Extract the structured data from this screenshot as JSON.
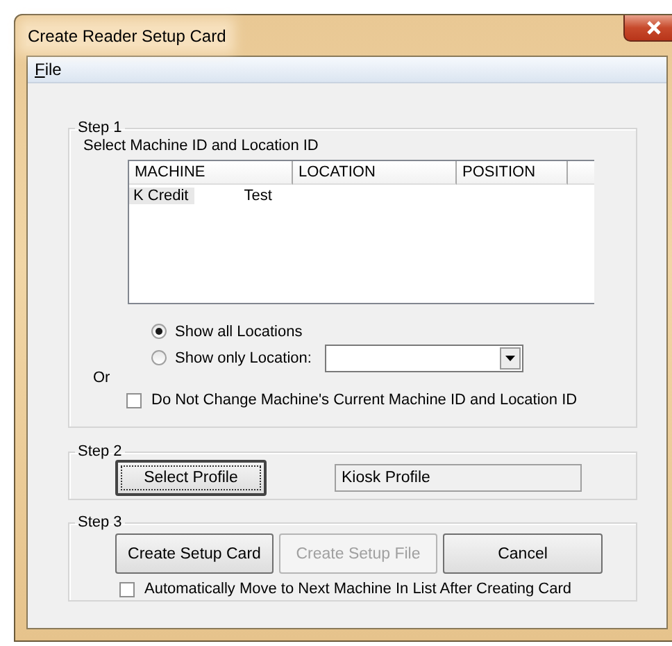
{
  "window": {
    "title": "Create Reader Setup Card"
  },
  "menu": [
    {
      "label": "File"
    }
  ],
  "step1": {
    "legend": "Step 1",
    "instruction": "Select Machine ID and Location ID",
    "columns": [
      "MACHINE",
      "LOCATION",
      "POSITION"
    ],
    "rows": [
      {
        "machine": "K Credit",
        "location": "Test",
        "selected": true
      }
    ],
    "radios": [
      {
        "label": "Show all Locations",
        "selected": true
      },
      {
        "label": "Show only Location:",
        "selected": false
      }
    ],
    "or_label": "Or",
    "checkbox": {
      "label": "Do Not Change Machine's Current Machine ID and Location ID",
      "checked": false
    }
  },
  "step2": {
    "legend": "Step 2",
    "button": "Select Profile",
    "profile_value": "Kiosk Profile"
  },
  "step3": {
    "legend": "Step 3",
    "buttons": [
      {
        "label": "Create Setup Card",
        "disabled": false
      },
      {
        "label": "Create Setup File",
        "disabled": true
      },
      {
        "label": "Cancel",
        "disabled": false
      }
    ],
    "checkbox": {
      "label": "Automatically Move to Next Machine In List After Creating Card",
      "checked": false
    }
  }
}
